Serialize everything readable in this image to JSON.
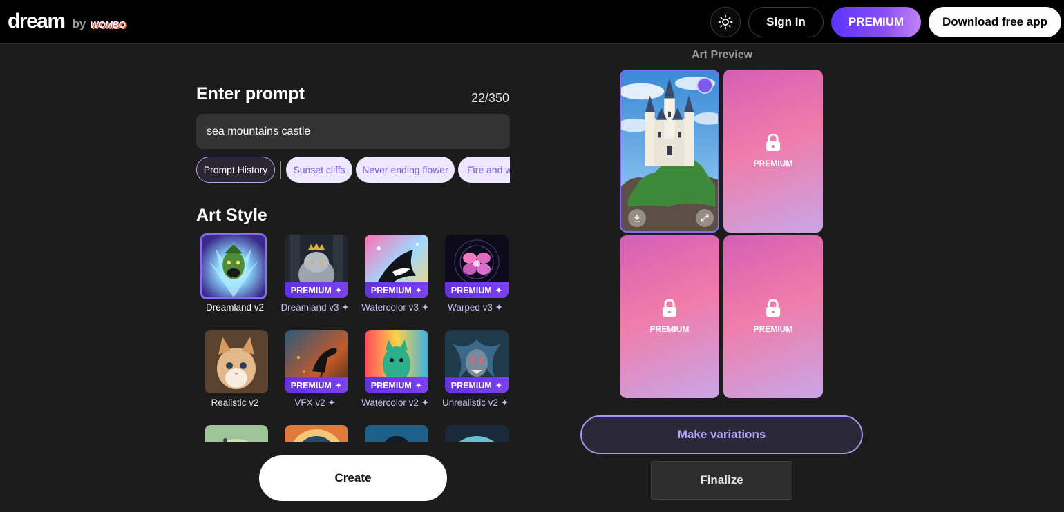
{
  "header": {
    "logo_dream": "dream",
    "logo_by": "by",
    "logo_wombo": "WOMBO",
    "sign_in": "Sign In",
    "premium": "PREMIUM",
    "download": "Download free app"
  },
  "prompt": {
    "heading": "Enter prompt",
    "count": "22/350",
    "value": "sea mountains castle",
    "history_chip": "Prompt History",
    "suggestions": [
      "Sunset cliffs",
      "Never ending flower",
      "Fire and water"
    ]
  },
  "art_style": {
    "heading": "Art Style",
    "premium_tag": "PREMIUM",
    "items": [
      {
        "label": "Dreamland v2",
        "premium": false,
        "selected": true
      },
      {
        "label": "Dreamland v3 ✦",
        "premium": true
      },
      {
        "label": "Watercolor v3 ✦",
        "premium": true
      },
      {
        "label": "Warped v3 ✦",
        "premium": true
      },
      {
        "label": "Realistic v2",
        "premium": false
      },
      {
        "label": "VFX v2 ✦",
        "premium": true
      },
      {
        "label": "Watercolor v2 ✦",
        "premium": true
      },
      {
        "label": "Unrealistic v2 ✦",
        "premium": true
      }
    ]
  },
  "create_button": "Create",
  "preview": {
    "title": "Art Preview",
    "locked_label": "PREMIUM",
    "make_variations": "Make variations",
    "finalize": "Finalize"
  },
  "icons": {
    "theme": "sun-icon",
    "lock": "lock-icon",
    "download": "download-icon",
    "expand": "expand-icon",
    "sparkle": "sparkle-icon"
  },
  "colors": {
    "accent": "#8b6cf5",
    "premium_gradient_start": "#5b34ff",
    "premium_gradient_end": "#c084f5",
    "locked_card": "#f07ba9",
    "background": "#1c1c1c"
  }
}
